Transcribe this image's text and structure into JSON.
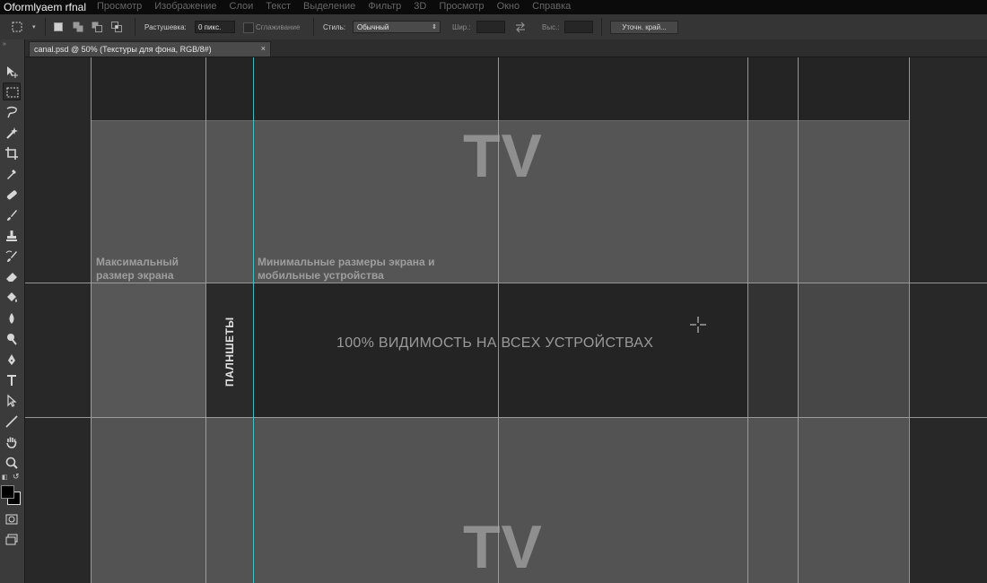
{
  "window": {
    "title": "Oformlyaem rfnal",
    "menus": [
      "Просмотр",
      "Изображение",
      "Слои",
      "Текст",
      "Выделение",
      "Фильтр",
      "3D",
      "Просмотр",
      "Окно",
      "Справка"
    ]
  },
  "options_bar": {
    "feather_label": "Растушевка:",
    "feather_value": "0 пикс.",
    "antialias_label": "Сглаживание",
    "style_label": "Стиль:",
    "style_value": "Обычный",
    "width_label": "Шир.:",
    "height_label": "Выс.:",
    "refine_button": "Уточн. край..."
  },
  "document_tab": {
    "label": "canal.psd @ 50% (Текстуры для фона, RGB/8#)",
    "close": "×"
  },
  "canvas": {
    "tv_top": "TV",
    "tv_bottom": "TV",
    "label_max": "Максимальный размер экрана",
    "label_min": "Минимальные размеры экрана и мобильные устройства",
    "center_text": "100% ВИДИМОСТЬ НА ВСЕХ УСТРОЙСТВАХ",
    "tablets": "ПАЛНШЕТЫ"
  },
  "colors": {
    "guide": "#3fd5d5",
    "panel_light": "#555555",
    "panel_dark": "#242424",
    "background": "#282828"
  },
  "toolbar": {
    "tools": [
      "move-icon",
      "marquee-icon",
      "lasso-icon",
      "magic-wand-icon",
      "crop-icon",
      "eyedropper-icon",
      "healing-brush-icon",
      "brush-icon",
      "clone-stamp-icon",
      "history-brush-icon",
      "eraser-icon",
      "paint-bucket-icon",
      "blur-icon",
      "dodge-icon",
      "pen-icon",
      "type-icon",
      "path-selection-icon",
      "line-icon",
      "hand-icon",
      "zoom-icon"
    ]
  }
}
